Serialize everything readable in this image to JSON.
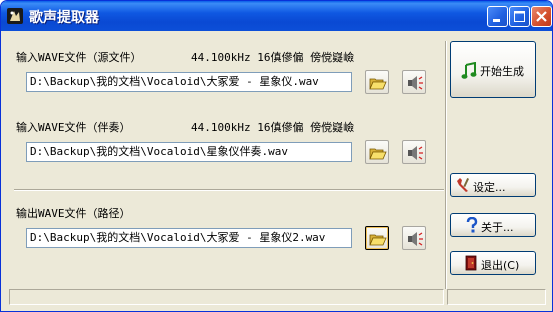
{
  "window": {
    "title": "歌声提取器"
  },
  "source": {
    "label": "输入WAVE文件（源文件）",
    "info": "44.100kHz 16傎傪偏 傍傥嶷嶮",
    "path": "D:\\Backup\\我的文档\\Vocaloid\\大冢爱 - 星象仪.wav"
  },
  "accompaniment": {
    "label": "输入WAVE文件（伴奏）",
    "info": "44.100kHz 16傎傪偏 傍傥嶷嶮",
    "path": "D:\\Backup\\我的文档\\Vocaloid\\星象仪伴奏.wav"
  },
  "output": {
    "label": "输出WAVE文件（路径）",
    "path": "D:\\Backup\\我的文档\\Vocaloid\\大冢爱 - 星象仪2.wav"
  },
  "buttons": {
    "start": "开始生成",
    "settings": "设定...",
    "about": "关于...",
    "exit": "退出(C)"
  },
  "icons": {
    "app": "app-icon",
    "browse": "folder-open-icon",
    "play": "speaker-icon",
    "start": "music-note-icon",
    "settings": "tools-icon",
    "about": "question-icon",
    "exit": "exit-door-icon"
  },
  "colors": {
    "titlebar": "#0a49d3",
    "close": "#d5522f",
    "face": "#ece9d8",
    "note": "#1f8a1f"
  }
}
